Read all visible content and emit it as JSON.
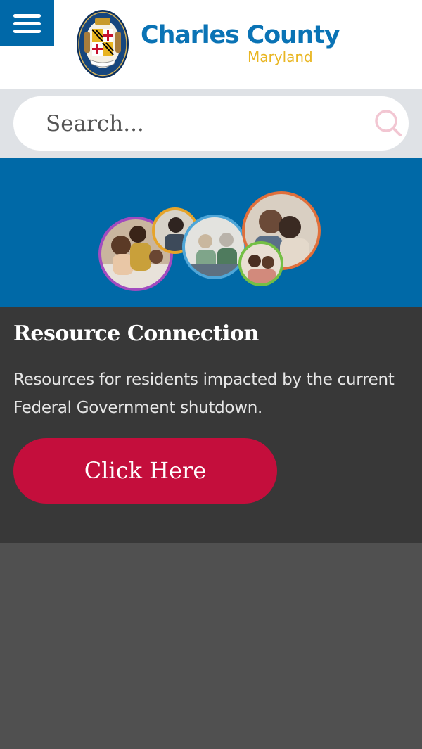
{
  "header": {
    "menu_icon": "hamburger-menu-icon",
    "seal_icon": "county-seal-icon",
    "title": "Charles County",
    "subtitle": "Maryland"
  },
  "search": {
    "placeholder": "Search...",
    "value": "",
    "icon": "search-icon"
  },
  "hero": {
    "image": "resource-connection-family-photos"
  },
  "card": {
    "title": "Resource Connection",
    "text": "Resources for residents impacted by the current Federal Government shutdown.",
    "button_label": "Click Here"
  },
  "colors": {
    "brand_blue": "#0a73b5",
    "brand_gold": "#e9b623",
    "hero_blue": "#0069a7",
    "card_bg": "#383838",
    "cta_red": "#c40e3c",
    "page_bg": "#505050"
  }
}
